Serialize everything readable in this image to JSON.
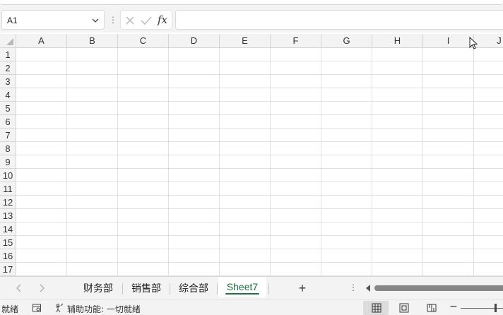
{
  "formula_bar": {
    "name_box_value": "A1",
    "fx_label": "fx",
    "formula_value": ""
  },
  "grid": {
    "columns": [
      "A",
      "B",
      "C",
      "D",
      "E",
      "F",
      "G",
      "H",
      "I",
      "J"
    ],
    "rows": [
      "1",
      "2",
      "3",
      "4",
      "5",
      "6",
      "7",
      "8",
      "9",
      "10",
      "11",
      "12",
      "13",
      "14",
      "15",
      "16",
      "17"
    ]
  },
  "sheet_tabs": {
    "tabs": [
      {
        "label": "财务部",
        "active": false
      },
      {
        "label": "销售部",
        "active": false
      },
      {
        "label": "综合部",
        "active": false
      },
      {
        "label": "Sheet7",
        "active": true
      }
    ],
    "add_label": "+",
    "more_label": "⋮"
  },
  "status_bar": {
    "ready_text": "就绪",
    "accessibility_text": "辅助功能: 一切就绪",
    "zoom_minus": "−"
  },
  "colors": {
    "active_tab_accent": "#1e7145",
    "chrome_bg": "#f3f3f3",
    "gridline": "#e1e1e1"
  },
  "icons": {
    "name_box_dropdown": "chevron-down-icon",
    "cancel": "x-icon",
    "enter": "check-icon",
    "select_all": "triangle-corner-icon",
    "cursor": "mouse-pointer-icon",
    "scroll_left": "chevron-left-icon",
    "scroll_right": "chevron-right-icon",
    "macro": "macro-recording-icon",
    "accessibility": "accessibility-icon",
    "normal_view": "grid-view-icon",
    "page_layout_view": "page-layout-icon",
    "page_break_view": "page-break-icon"
  }
}
